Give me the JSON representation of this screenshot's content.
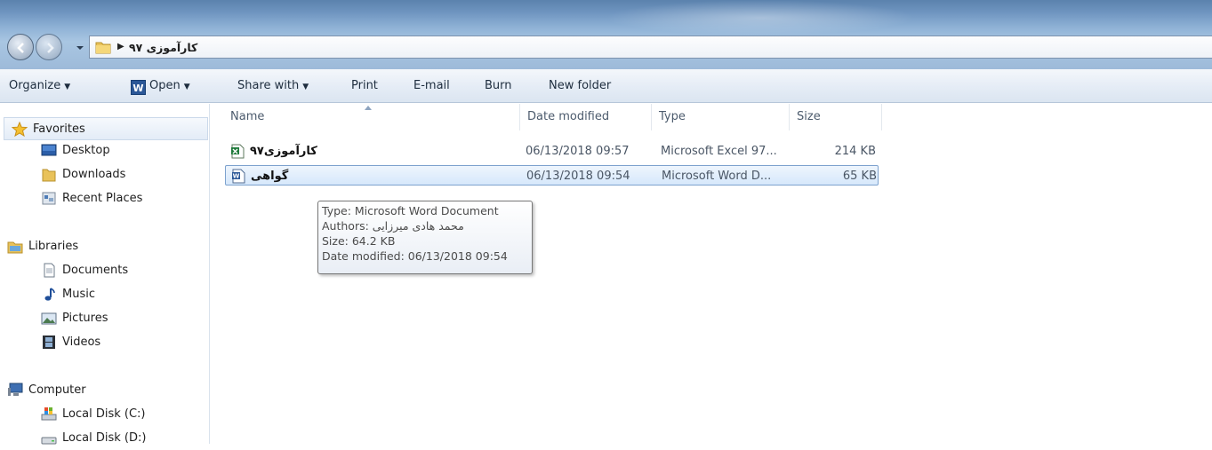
{
  "address": {
    "path": "کارآموزی ۹۷"
  },
  "toolbar": {
    "organize": "Organize",
    "open": "Open",
    "share_with": "Share with",
    "print": "Print",
    "email": "E-mail",
    "burn": "Burn",
    "new_folder": "New folder"
  },
  "sidebar": {
    "favorites": "Favorites",
    "desktop": "Desktop",
    "downloads": "Downloads",
    "recent_places": "Recent Places",
    "libraries": "Libraries",
    "documents": "Documents",
    "music": "Music",
    "pictures": "Pictures",
    "videos": "Videos",
    "computer": "Computer",
    "local_c": "Local Disk (C:)",
    "local_d": "Local Disk (D:)"
  },
  "columns": {
    "name": "Name",
    "date_modified": "Date modified",
    "type": "Type",
    "size": "Size"
  },
  "files": [
    {
      "name": "کارآموزی۹۷",
      "date": "06/13/2018 09:57",
      "type": "Microsoft Excel 97...",
      "size": "214 KB"
    },
    {
      "name": "گواهی",
      "date": "06/13/2018 09:54",
      "type": "Microsoft Word D...",
      "size": "65 KB"
    }
  ],
  "tooltip": {
    "type": "Type: Microsoft Word Document",
    "authors": "Authors: محمد هادی میرزایی",
    "size": "Size: 64.2 KB",
    "date": "Date modified: 06/13/2018 09:54"
  }
}
